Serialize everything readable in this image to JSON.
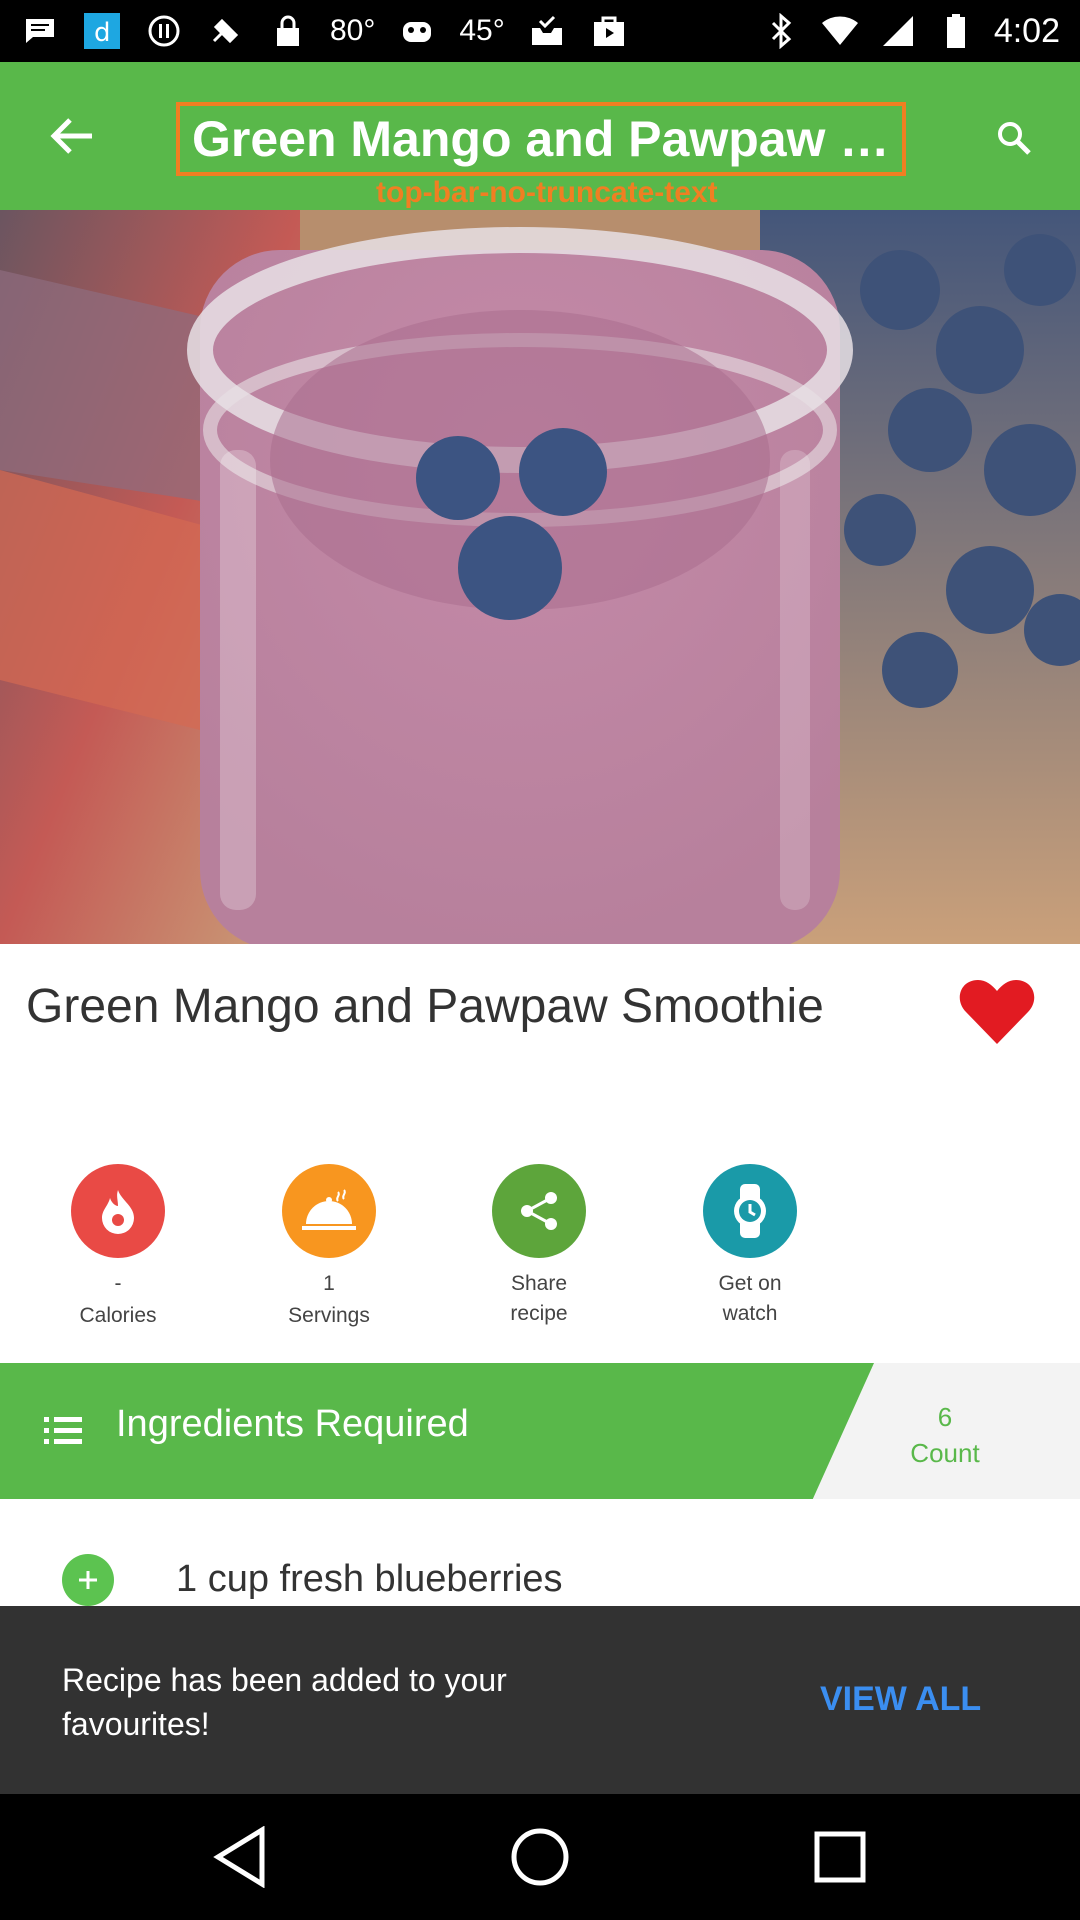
{
  "status_bar": {
    "temp_1": "80°",
    "temp_2": "45°",
    "time": "4:02"
  },
  "top_bar": {
    "title": "Green Mango and Pawpaw S…",
    "debug_label": "top-bar-no-truncate-text",
    "color": "#59b84a"
  },
  "recipe": {
    "title": "Green Mango and Pawpaw Smoothie",
    "favourite": true
  },
  "actions": [
    {
      "value": "-",
      "label": "Calories",
      "icon": "flame-icon",
      "color": "#e94a45"
    },
    {
      "value": "1",
      "label": "Servings",
      "icon": "serving-dish-icon",
      "color": "#f8961f"
    },
    {
      "value": "Share",
      "label": "recipe",
      "icon": "share-icon",
      "color": "#5da53b"
    },
    {
      "value": "Get on",
      "label": "watch",
      "icon": "watch-icon",
      "color": "#1a9aa8"
    }
  ],
  "ingredients": {
    "header": "Ingredients Required",
    "count_value": "6",
    "count_label": "Count",
    "items": [
      "1 cup fresh blueberries"
    ]
  },
  "snackbar": {
    "message": "Recipe has been added to your favourites!",
    "action": "VIEW ALL"
  }
}
